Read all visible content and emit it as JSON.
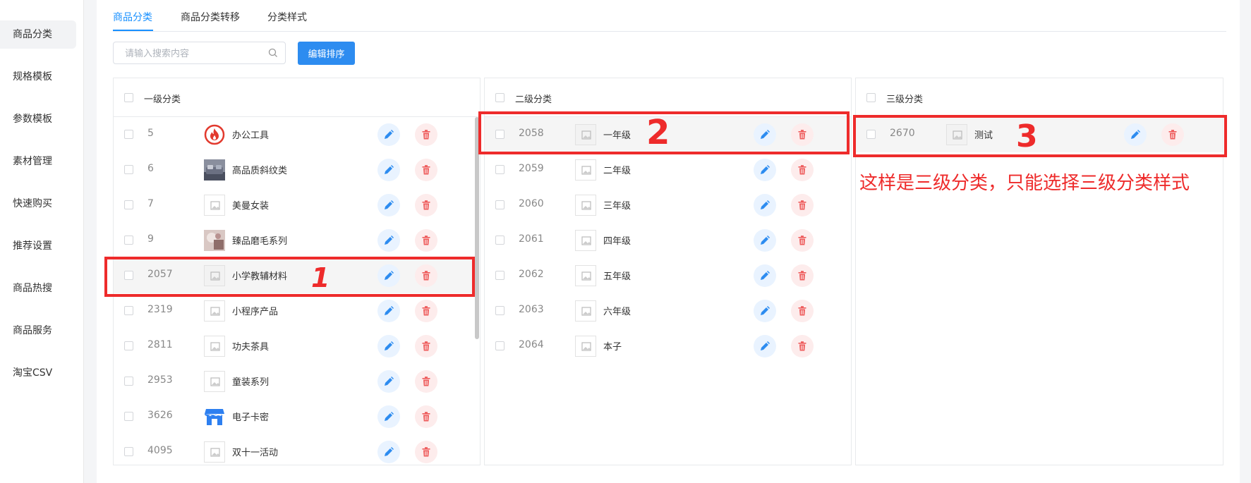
{
  "sidebar": {
    "items": [
      {
        "label": "商品分类",
        "active": true
      },
      {
        "label": "规格模板"
      },
      {
        "label": "参数模板"
      },
      {
        "label": "素材管理"
      },
      {
        "label": "快速购买"
      },
      {
        "label": "推荐设置"
      },
      {
        "label": "商品热搜"
      },
      {
        "label": "商品服务"
      },
      {
        "label": "淘宝CSV"
      }
    ]
  },
  "tabs": [
    {
      "label": "商品分类",
      "active": true
    },
    {
      "label": "商品分类转移"
    },
    {
      "label": "分类样式"
    }
  ],
  "toolbar": {
    "search_placeholder": "请输入搜索内容",
    "search_value": "",
    "sort_button_label": "编辑排序"
  },
  "panels": {
    "level1": {
      "title": "一级分类",
      "rows": [
        {
          "id": "5",
          "name": "办公工具",
          "icon": "fire-logo-icon"
        },
        {
          "id": "6",
          "name": "高品质斜纹类",
          "icon": "sofa-photo-icon"
        },
        {
          "id": "7",
          "name": "美曼女装",
          "icon": "image-placeholder-icon"
        },
        {
          "id": "9",
          "name": "臻品磨毛系列",
          "icon": "product-photo-icon"
        },
        {
          "id": "2057",
          "name": "小学教辅材料",
          "icon": "image-placeholder-icon",
          "highlighted": true
        },
        {
          "id": "2319",
          "name": "小程序产品",
          "icon": "image-placeholder-icon"
        },
        {
          "id": "2811",
          "name": "功夫茶具",
          "icon": "image-placeholder-icon"
        },
        {
          "id": "2953",
          "name": "童装系列",
          "icon": "image-placeholder-icon"
        },
        {
          "id": "3626",
          "name": "电子卡密",
          "icon": "store-icon"
        },
        {
          "id": "4095",
          "name": "双十一活动",
          "icon": "image-placeholder-icon"
        }
      ]
    },
    "level2": {
      "title": "二级分类",
      "rows": [
        {
          "id": "2058",
          "name": "一年级",
          "icon": "image-placeholder-icon",
          "highlighted": true
        },
        {
          "id": "2059",
          "name": "二年级",
          "icon": "image-placeholder-icon"
        },
        {
          "id": "2060",
          "name": "三年级",
          "icon": "image-placeholder-icon"
        },
        {
          "id": "2061",
          "name": "四年级",
          "icon": "image-placeholder-icon"
        },
        {
          "id": "2062",
          "name": "五年级",
          "icon": "image-placeholder-icon"
        },
        {
          "id": "2063",
          "name": "六年级",
          "icon": "image-placeholder-icon"
        },
        {
          "id": "2064",
          "name": "本子",
          "icon": "image-placeholder-icon"
        }
      ]
    },
    "level3": {
      "title": "三级分类",
      "rows": [
        {
          "id": "2670",
          "name": "测试",
          "icon": "image-placeholder-icon",
          "highlighted": true
        }
      ]
    }
  },
  "annotations": {
    "num1": "1",
    "num2": "2",
    "num3": "3",
    "note": "这样是三级分类，只能选择三级分类样式"
  },
  "colors": {
    "accent": "#1890ff",
    "primary_button": "#2d8cf0",
    "edit_icon": "#2d8cf0",
    "delete_icon": "#ee5c5c",
    "annotation": "#ee2b2b"
  }
}
